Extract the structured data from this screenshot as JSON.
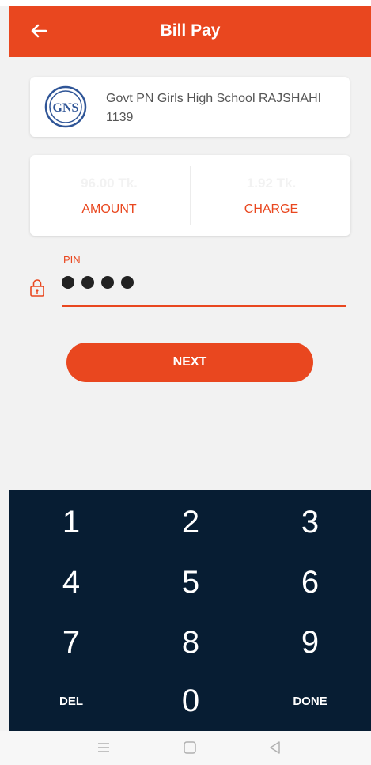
{
  "header": {
    "title": "Bill Pay"
  },
  "biller": {
    "name": "Govt PN Girls High School RAJSHAHI",
    "code": "1139",
    "logo_text": "GNS"
  },
  "summary": {
    "amount_value": "96.00 Tk.",
    "amount_label": "AMOUNT",
    "charge_value": "1.92 Tk.",
    "charge_label": "CHARGE"
  },
  "pin": {
    "label": "PIN",
    "filled_digits": 4
  },
  "next_button": {
    "label": "NEXT"
  },
  "keypad": {
    "keys": [
      "1",
      "2",
      "3",
      "4",
      "5",
      "6",
      "7",
      "8",
      "9",
      "DEL",
      "0",
      "DONE"
    ]
  },
  "colors": {
    "accent": "#e9471f",
    "keypad_bg": "#071d33"
  },
  "icons": {
    "back": "arrow-left-icon",
    "lock": "lock-icon",
    "nav": [
      "menu-icon",
      "home-square-icon",
      "back-triangle-icon"
    ]
  }
}
